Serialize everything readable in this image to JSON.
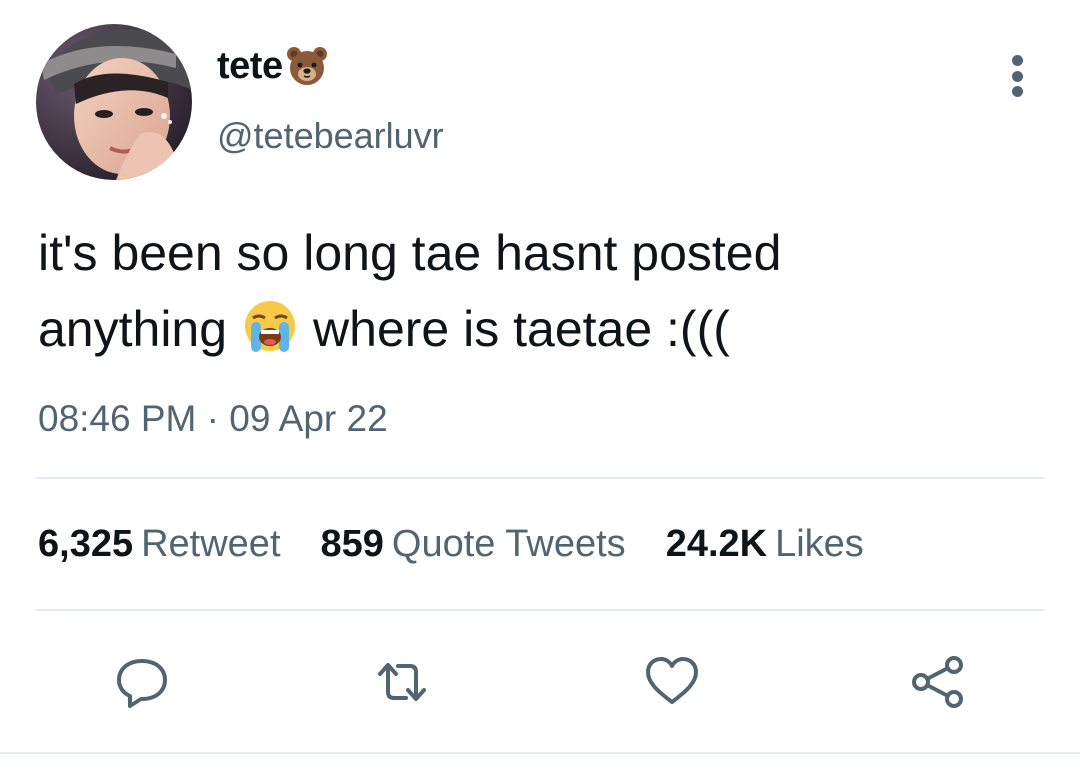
{
  "author": {
    "display_name": "tete",
    "name_emoji": "bear-face-emoji",
    "handle": "@tetebearluvr",
    "avatar": "profile-photo"
  },
  "tweet": {
    "line1": "it's been so long tae hasnt posted",
    "line2_before": "anything",
    "line2_emoji": "loudly-crying-face-emoji",
    "line2_after": "where is taetae :((("
  },
  "meta": {
    "time": "08:46 PM",
    "separator": "·",
    "date": "09 Apr 22"
  },
  "stats": {
    "retweets_count": "6,325",
    "retweets_label": "Retweet",
    "quotes_count": "859",
    "quotes_label": "Quote Tweets",
    "likes_count": "24.2K",
    "likes_label": "Likes"
  },
  "actions": {
    "reply_icon": "speech-bubble-icon",
    "retweet_icon": "retweet-arrows-icon",
    "like_icon": "heart-icon",
    "share_icon": "share-nodes-icon"
  },
  "colors": {
    "text_primary": "#0f1419",
    "text_secondary": "#536471",
    "divider": "#e6ecf0"
  }
}
